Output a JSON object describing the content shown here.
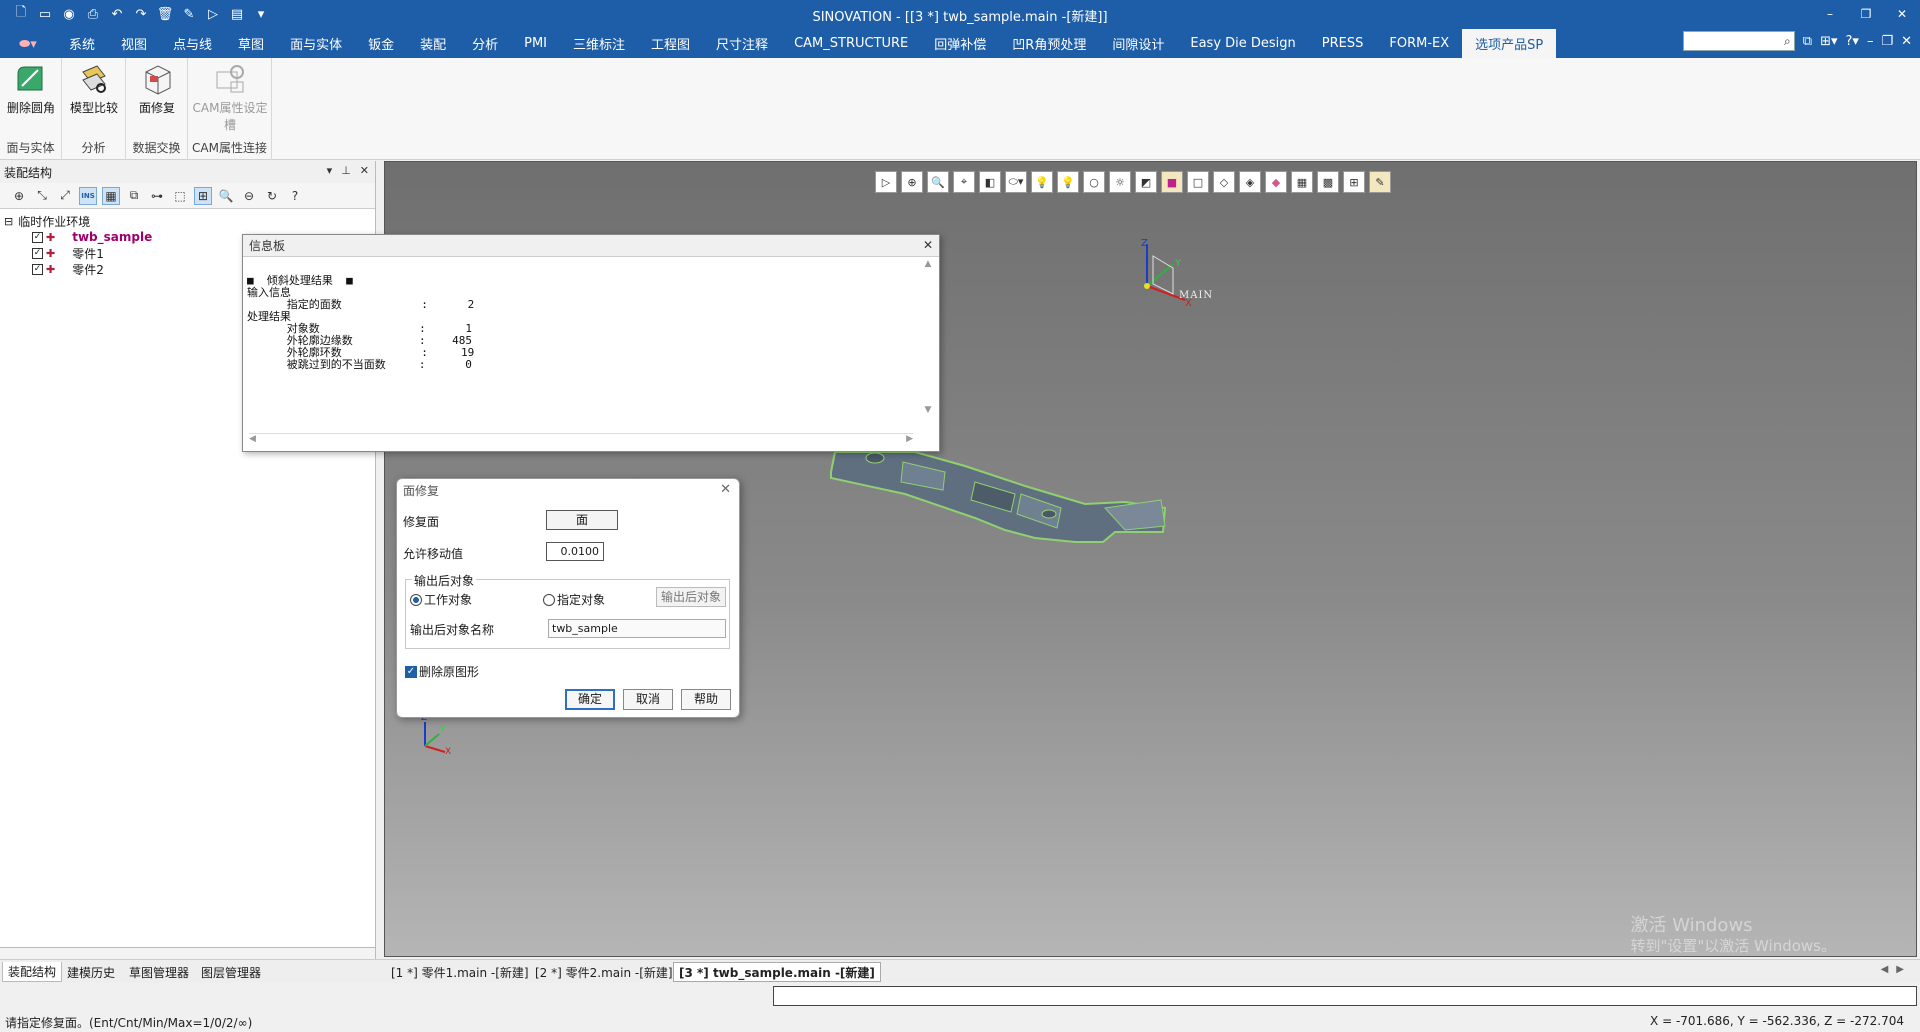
{
  "titlebar": {
    "title": "SINOVATION - [[3 *] twb_sample.main -[新建]]",
    "qat_icons": [
      "new-file-icon",
      "open-icon",
      "save-icon",
      "print-icon",
      "undo-icon",
      "redo-icon",
      "delete-icon",
      "pen-icon",
      "play-icon",
      "separator",
      "layer-icon",
      "dropdown-icon"
    ]
  },
  "menubar": {
    "items": [
      "系统",
      "视图",
      "点与线",
      "草图",
      "面与实体",
      "钣金",
      "装配",
      "分析",
      "PMI",
      "三维标注",
      "工程图",
      "尺寸注释",
      "CAM_STRUCTURE",
      "回弹补偿",
      "凹R角预处理",
      "间隙设计",
      "Easy Die Design",
      "PRESS",
      "FORM-EX",
      "选项产品SP"
    ],
    "active_index": 19
  },
  "ribbon": {
    "groups": [
      {
        "label": "面与实体",
        "buttons": [
          {
            "label": "删除圆角"
          }
        ]
      },
      {
        "label": "分析",
        "buttons": [
          {
            "label": "模型比较"
          }
        ]
      },
      {
        "label": "数据交换",
        "buttons": [
          {
            "label": "面修复"
          }
        ]
      },
      {
        "label": "CAM属性连接",
        "buttons": [
          {
            "label": "CAM属性设定槽",
            "label_line1": "CAM属性设定",
            "label_line2": "槽"
          }
        ]
      }
    ]
  },
  "leftpanel": {
    "title": "装配结构",
    "tree": {
      "root": "临时作业环境",
      "children": [
        {
          "label": "twb_sample",
          "checked": true,
          "active": true
        },
        {
          "label": "零件1",
          "checked": true,
          "active": false
        },
        {
          "label": "零件2",
          "checked": true,
          "active": false
        }
      ]
    },
    "tabs": [
      "装配结构",
      "建模历史",
      "草图管理器",
      "图层管理器"
    ]
  },
  "doc_tabs": [
    "[1 *] 零件1.main -[新建]",
    "[2 *] 零件2.main -[新建]",
    "[3 *] twb_sample.main -[新建]"
  ],
  "info_panel": {
    "title": "信息板",
    "lines": [
      "■  倾斜处理结果  ■",
      "输入信息",
      "      指定的面数            :      2",
      "处理结果",
      "      对象数               :      1",
      "      外轮廓边缘数          :    485",
      "      外轮廓环数            :     19",
      "      被跳过到的不当面数     :      0"
    ]
  },
  "repair_dialog": {
    "title": "面修复",
    "face_label": "修复面",
    "face_button": "面",
    "tolerance_label": "允许移动值",
    "tolerance_value": "0.0100",
    "output_group_title": "输出后对象",
    "radio_work": "工作对象",
    "radio_specified": "指定对象",
    "output_button": "输出后对象",
    "output_name_label": "输出后对象名称",
    "output_name_value": "twb_sample",
    "delete_original_label": "删除原图形",
    "delete_original_checked": true,
    "ok": "确定",
    "cancel": "取消",
    "help": "帮助"
  },
  "viewport": {
    "axis_label": "MAIN",
    "watermark_line1": "激活 Windows",
    "watermark_line2": "转到\"设置\"以激活 Windows。"
  },
  "statusbar": {
    "prompt": "请指定修复面。(Ent/Cnt/Min/Max=1/0/2/∞)",
    "coords": "X = -701.686, Y = -562.336, Z = -272.704"
  },
  "colors": {
    "titlebar_bg": "#1e5ea8",
    "active_tree_item": "#a0006e",
    "part_fill": "#5f6f80",
    "part_edge": "#8fd070"
  }
}
